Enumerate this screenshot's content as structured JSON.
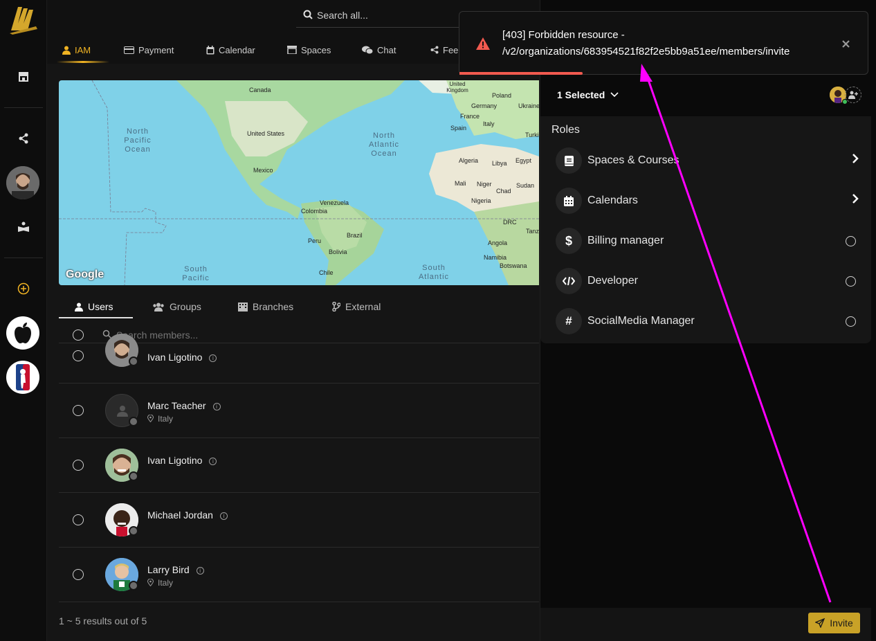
{
  "topbar": {
    "search_placeholder": "Search all...",
    "tabs": [
      {
        "label": "IAM",
        "icon": "user-icon",
        "active": true
      },
      {
        "label": "Payment",
        "icon": "credit-card-icon"
      },
      {
        "label": "Calendar",
        "icon": "calendar-icon"
      },
      {
        "label": "Spaces",
        "icon": "spaces-icon"
      },
      {
        "label": "Chat",
        "icon": "chat-icon"
      },
      {
        "label": "Feed",
        "icon": "share-icon"
      }
    ]
  },
  "map": {
    "oceans": [
      "North Pacific Ocean",
      "North Atlantic Ocean",
      "South Pacific",
      "South Atlantic"
    ],
    "countries": [
      "Canada",
      "United States",
      "Mexico",
      "Venezuela",
      "Colombia",
      "Peru",
      "Brazil",
      "Bolivia",
      "Chile",
      "United Kingdom",
      "Poland",
      "Germany",
      "Ukraine",
      "France",
      "Italy",
      "Spain",
      "Turki",
      "Algeria",
      "Libya",
      "Egypt",
      "Mali",
      "Niger",
      "Chad",
      "Sudan",
      "Nigeria",
      "DRC",
      "Tanz",
      "Angola",
      "Namibia",
      "Botswana"
    ],
    "logo": "Google"
  },
  "member_tabs": [
    {
      "label": "Users",
      "icon": "user-icon",
      "active": true
    },
    {
      "label": "Groups",
      "icon": "group-icon"
    },
    {
      "label": "Branches",
      "icon": "building-icon"
    },
    {
      "label": "External",
      "icon": "branch-icon"
    }
  ],
  "search_members_placeholder": "Search members...",
  "members": [
    {
      "name": "Ivan Ligotino",
      "location": ""
    },
    {
      "name": "Marc Teacher",
      "location": "Italy"
    },
    {
      "name": "Ivan Ligotino",
      "location": ""
    },
    {
      "name": "Michael Jordan",
      "location": ""
    },
    {
      "name": "Larry Bird",
      "location": "Italy"
    }
  ],
  "results_text": "1 ~ 5 results out of 5",
  "panel": {
    "selected_label": "1 Selected",
    "roles_title": "Roles",
    "roles": [
      {
        "label": "Spaces & Courses",
        "icon": "book-icon",
        "kind": "chevron"
      },
      {
        "label": "Calendars",
        "icon": "calendar-icon",
        "kind": "chevron"
      },
      {
        "label": "Billing manager",
        "icon": "dollar-icon",
        "kind": "radio"
      },
      {
        "label": "Developer",
        "icon": "code-icon",
        "kind": "radio"
      },
      {
        "label": "SocialMedia Manager",
        "icon": "hashtag-icon",
        "kind": "radio"
      }
    ],
    "invite_label": "Invite"
  },
  "toast": {
    "line1": "[403] Forbidden resource -",
    "line2": "/v2/organizations/683954521f82f2e5bb9a51ee/members/invite",
    "progress": 0.3
  },
  "colors": {
    "accent": "#f0b323",
    "invite_bg": "#c9a227",
    "toast_progress": "#f15a4f",
    "annotation_arrow": "#ff00ff"
  }
}
